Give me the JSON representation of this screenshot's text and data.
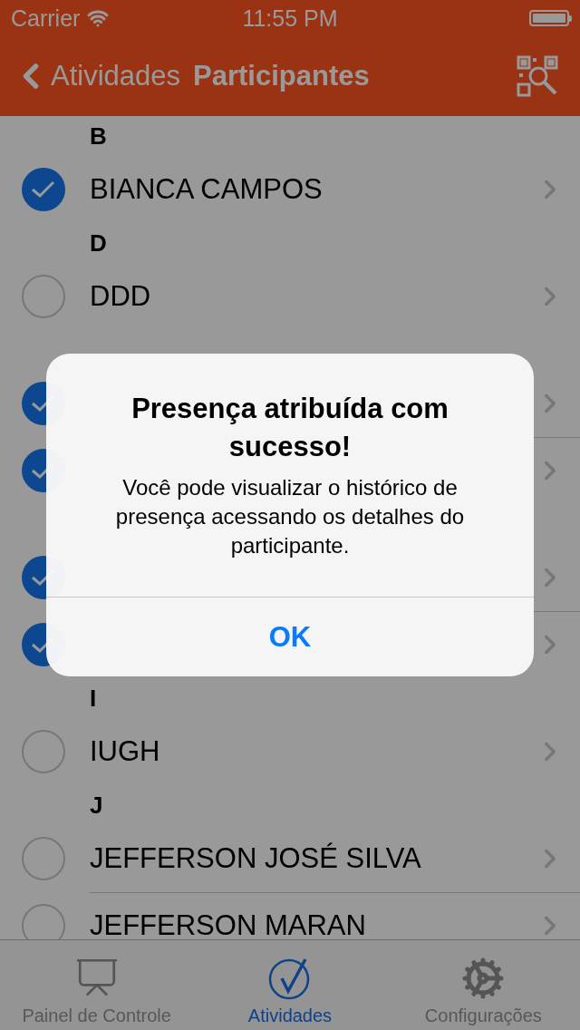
{
  "status_bar": {
    "carrier": "Carrier",
    "time": "11:55 PM"
  },
  "nav": {
    "back": "Atividades",
    "title": "Participantes"
  },
  "sections": [
    {
      "letter": "B",
      "rows": [
        {
          "name": "BIANCA CAMPOS",
          "checked": true
        }
      ]
    },
    {
      "letter": "D",
      "rows": [
        {
          "name": "DDD",
          "checked": false
        }
      ]
    },
    {
      "rows": [
        {
          "checked": true
        },
        {
          "checked": true
        }
      ]
    },
    {
      "rows": [
        {
          "checked": true
        },
        {
          "checked": true
        }
      ]
    },
    {
      "letter": "I",
      "rows": [
        {
          "name": "IUGH",
          "checked": false
        }
      ]
    },
    {
      "letter": "J",
      "rows": [
        {
          "name": "JEFFERSON JOSÉ SILVA",
          "checked": false
        },
        {
          "name": "JEFFERSON MARAN",
          "checked": false
        }
      ]
    }
  ],
  "alert": {
    "title": "Presença atribuída com sucesso!",
    "message": "Você pode visualizar o histórico de presença acessando os detalhes do participante.",
    "button": "OK"
  },
  "tabs": [
    {
      "label": "Painel de Controle",
      "kind": "chart",
      "selected": false
    },
    {
      "label": "Atividades",
      "kind": "check",
      "selected": true
    },
    {
      "label": "Configurações",
      "kind": "gear",
      "selected": false
    }
  ]
}
